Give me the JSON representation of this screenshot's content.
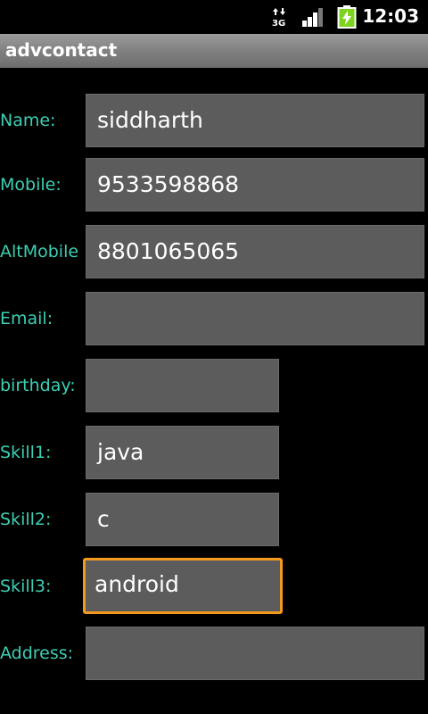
{
  "status_bar": {
    "time": "12:03",
    "network": "3G",
    "icons": [
      "data-3g-icon",
      "signal-strength-icon",
      "battery-charging-icon"
    ]
  },
  "app": {
    "title": "advcontact"
  },
  "form": {
    "name": {
      "label": "Name:",
      "value": "siddharth"
    },
    "mobile": {
      "label": "Mobile:",
      "value": "9533598868"
    },
    "altmobile": {
      "label": "AltMobile",
      "value": "8801065065"
    },
    "email": {
      "label": "Email:",
      "value": ""
    },
    "birthday": {
      "label": "birthday:",
      "value": ""
    },
    "skill1": {
      "label": "Skill1:",
      "value": "java"
    },
    "skill2": {
      "label": "Skill2:",
      "value": "c"
    },
    "skill3": {
      "label": "Skill3:",
      "value": "android"
    },
    "address": {
      "label": "Address:",
      "value": ""
    }
  },
  "colors": {
    "label": "#3ccfb4",
    "field_bg": "#5c5c5c",
    "focus_border": "#f39a1e",
    "background": "#000000"
  }
}
